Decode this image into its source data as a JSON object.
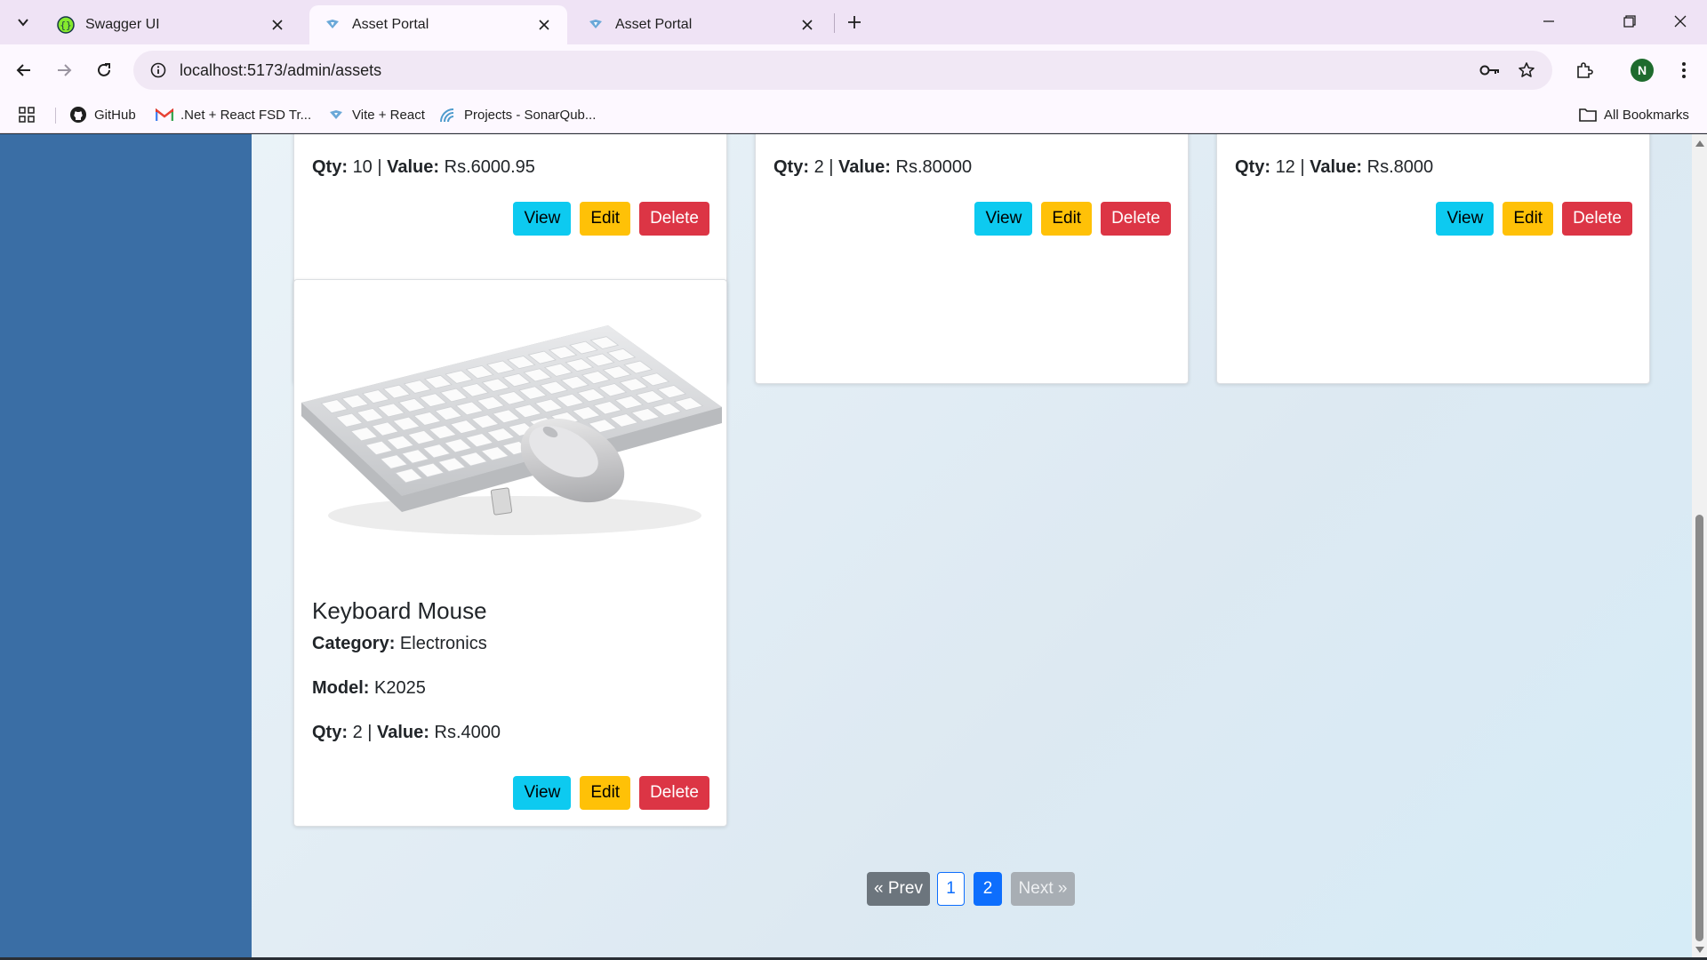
{
  "browser": {
    "tabs": [
      {
        "title": "Swagger UI",
        "active": false
      },
      {
        "title": "Asset Portal",
        "active": true
      },
      {
        "title": "Asset Portal",
        "active": false
      }
    ],
    "url": "localhost:5173/admin/assets",
    "profile_initial": "N",
    "bookmarks": [
      {
        "label": "GitHub",
        "icon": "github-icon"
      },
      {
        "label": ".Net + React FSD Tr...",
        "icon": "gmail-icon"
      },
      {
        "label": "Vite + React",
        "icon": "react-icon"
      },
      {
        "label": "Projects - SonarQub...",
        "icon": "sonarqube-icon"
      }
    ],
    "all_bookmarks_label": "All Bookmarks"
  },
  "labels": {
    "category": "Category:",
    "model": "Model:",
    "qty": "Qty:",
    "value": "Value:",
    "separator": "|"
  },
  "assets": [
    {
      "qty": "10",
      "value": "Rs.6000.95",
      "view": "View",
      "edit": "Edit",
      "delete": "Delete"
    },
    {
      "qty": "2",
      "value": "Rs.80000",
      "view": "View",
      "edit": "Edit",
      "delete": "Delete"
    },
    {
      "qty": "12",
      "value": "Rs.8000",
      "view": "View",
      "edit": "Edit",
      "delete": "Delete"
    },
    {
      "name": "Keyboard Mouse",
      "category": "Electronics",
      "model": "K2025",
      "qty": "2",
      "value": "Rs.4000",
      "view": "View",
      "edit": "Edit",
      "delete": "Delete",
      "image": "keyboard-mouse-image"
    }
  ],
  "pagination": {
    "prev": "« Prev",
    "pages": [
      "1",
      "2"
    ],
    "current": "2",
    "next": "Next »"
  },
  "colors": {
    "sidebar": "#3a6ea5",
    "view_button": "#0dcaf0",
    "edit_button": "#ffc107",
    "delete_button": "#dc3545",
    "primary": "#0d6efd",
    "secondary": "#6c757d"
  }
}
